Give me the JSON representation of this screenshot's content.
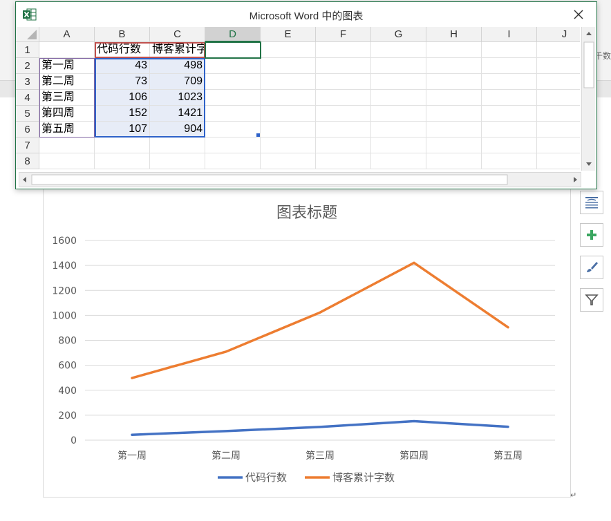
{
  "background": {
    "ribbon_right_label": "千数"
  },
  "excel": {
    "window_title": "Microsoft Word 中的图表",
    "icon": "excel-icon",
    "columns": [
      "A",
      "B",
      "C",
      "D",
      "E",
      "F",
      "G",
      "H",
      "I",
      "J"
    ],
    "selected_column": "D",
    "rows": [
      "1",
      "2",
      "3",
      "4",
      "5",
      "6",
      "7",
      "8"
    ],
    "cells": [
      [
        "",
        "代码行数",
        "博客累计字数",
        ""
      ],
      [
        "第一周",
        "43",
        "498"
      ],
      [
        "第二周",
        "73",
        "709"
      ],
      [
        "第三周",
        "106",
        "1023"
      ],
      [
        "第四周",
        "152",
        "1421"
      ],
      [
        "第五周",
        "107",
        "904"
      ]
    ]
  },
  "side_buttons": [
    {
      "name": "layout-options-button",
      "icon": "layout-options-icon"
    },
    {
      "name": "chart-elements-button",
      "icon": "plus-icon"
    },
    {
      "name": "chart-styles-button",
      "icon": "brush-icon"
    },
    {
      "name": "chart-filters-button",
      "icon": "filter-icon"
    }
  ],
  "chart_data": {
    "type": "line",
    "title": "图表标题",
    "categories": [
      "第一周",
      "第二周",
      "第三周",
      "第四周",
      "第五周"
    ],
    "series": [
      {
        "name": "代码行数",
        "values": [
          43,
          73,
          106,
          152,
          107
        ],
        "color": "#4472c4"
      },
      {
        "name": "博客累计字数",
        "values": [
          498,
          709,
          1023,
          1421,
          904
        ],
        "color": "#ed7d31"
      }
    ],
    "ylim": [
      0,
      1600
    ],
    "yticks": [
      "0",
      "200",
      "400",
      "600",
      "800",
      "1000",
      "1200",
      "1400",
      "1600"
    ],
    "grid": true,
    "legend_position": "bottom"
  },
  "paragraph_mark": "↵"
}
